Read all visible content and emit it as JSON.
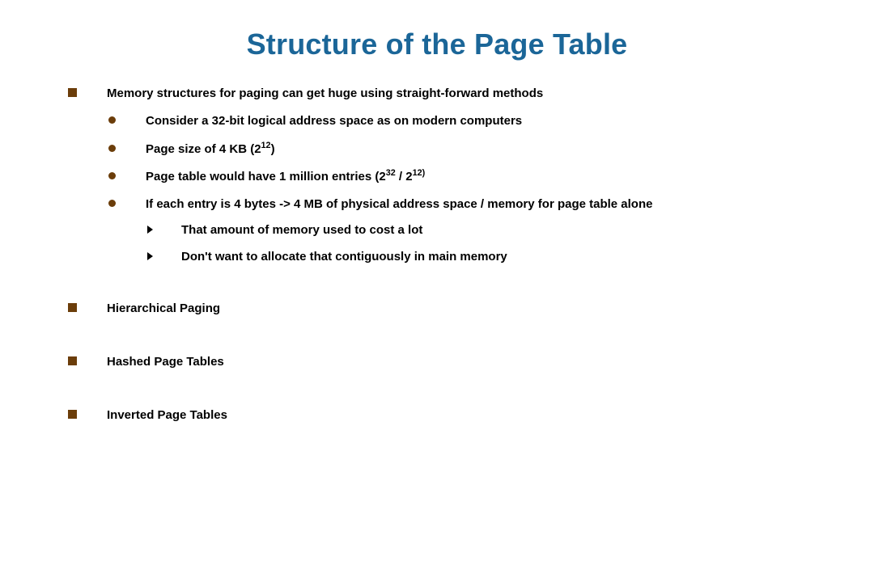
{
  "title": "Structure of the Page Table",
  "bullets": {
    "b1": "Memory structures for paging can get huge using straight-forward methods",
    "b1a": "Consider a 32-bit logical address space as on modern computers",
    "b1b_pre": "Page size of 4 KB (2",
    "b1b_sup": "12",
    "b1b_post": ")",
    "b1c_pre": "Page table would have 1 million entries (2",
    "b1c_sup1": "32",
    "b1c_mid": " / 2",
    "b1c_sup2": "12)",
    "b1d": "If each entry is 4 bytes -> 4 MB of physical address space / memory for page table alone",
    "b1d_i": "That amount of memory used to cost a lot",
    "b1d_ii": "Don't want to allocate that contiguously in main memory",
    "b2": "Hierarchical Paging",
    "b3": "Hashed Page Tables",
    "b4": "Inverted Page Tables"
  }
}
